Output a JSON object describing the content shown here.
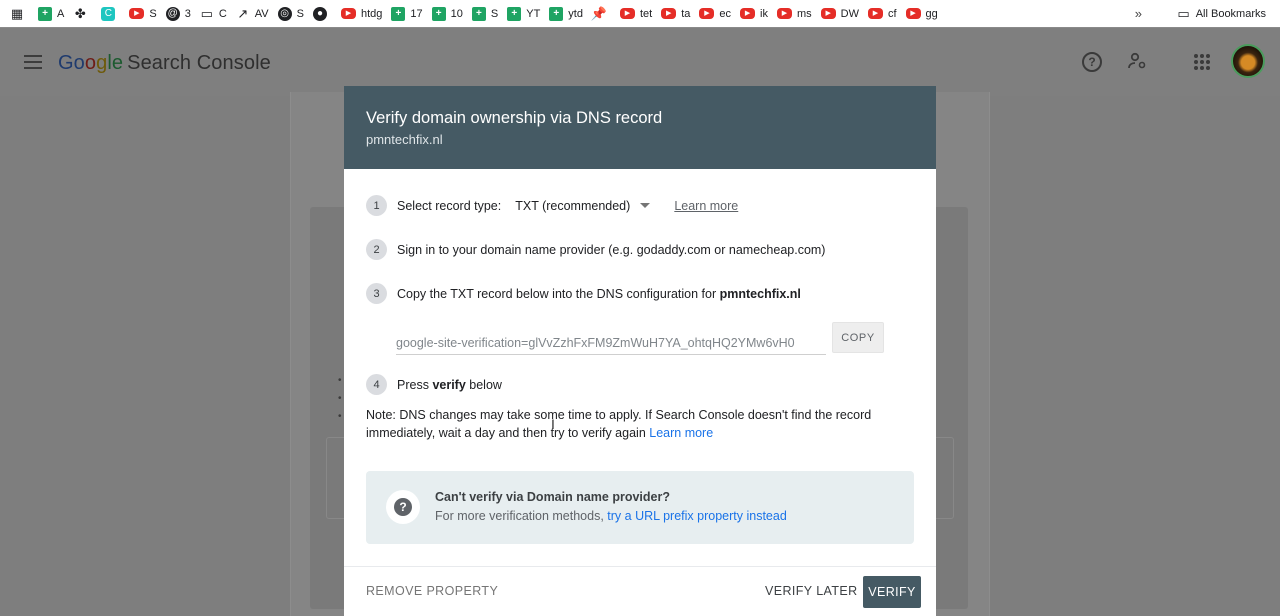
{
  "bookmarks": {
    "items": [
      {
        "label": "",
        "icon": "apps-grid-icon"
      },
      {
        "label": "A",
        "icon": "sheets-icon"
      },
      {
        "label": "",
        "icon": "puzzle-icon"
      },
      {
        "label": "",
        "icon": "canva-icon"
      },
      {
        "label": "S",
        "icon": "youtube-icon"
      },
      {
        "label": "3",
        "icon": "threads-icon"
      },
      {
        "label": "C",
        "icon": "folder-icon"
      },
      {
        "label": "AV",
        "icon": "trend-icon"
      },
      {
        "label": "S",
        "icon": "globe-icon"
      },
      {
        "label": "",
        "icon": "github-icon"
      },
      {
        "label": "htdg",
        "icon": "youtube-icon"
      },
      {
        "label": "17",
        "icon": "sheets-icon"
      },
      {
        "label": "10",
        "icon": "sheets-icon"
      },
      {
        "label": "S",
        "icon": "sheets-icon"
      },
      {
        "label": "YT",
        "icon": "sheets-icon"
      },
      {
        "label": "ytd",
        "icon": "sheets-icon"
      },
      {
        "label": "",
        "icon": "pin-icon"
      },
      {
        "label": "tet",
        "icon": "youtube-icon"
      },
      {
        "label": "ta",
        "icon": "youtube-icon"
      },
      {
        "label": "ec",
        "icon": "youtube-icon"
      },
      {
        "label": "ik",
        "icon": "youtube-icon"
      },
      {
        "label": "ms",
        "icon": "youtube-icon"
      },
      {
        "label": "DW",
        "icon": "youtube-icon"
      },
      {
        "label": "cf",
        "icon": "youtube-icon"
      },
      {
        "label": "gg",
        "icon": "youtube-icon"
      }
    ],
    "more": "»",
    "all_bookmarks": "All Bookmarks"
  },
  "header": {
    "logo_g": [
      "Go",
      "o",
      "g",
      "le"
    ],
    "product": "Search Console",
    "help": "?"
  },
  "dialog": {
    "title": "Verify domain ownership via DNS record",
    "subtitle": "pmntechfix.nl",
    "steps": [
      {
        "num": "1",
        "text": "Select record type:",
        "select_value": "TXT (recommended)",
        "link": "Learn more"
      },
      {
        "num": "2",
        "text": "Sign in to your domain name provider (e.g. godaddy.com or namecheap.com)"
      },
      {
        "num": "3",
        "text_pre": "Copy the TXT record below into the DNS configuration for ",
        "text_bold": "pmntechfix.nl"
      },
      {
        "num": "4",
        "text_pre": "Press ",
        "text_bold": "verify",
        "text_post": " below"
      }
    ],
    "txt_record": "google-site-verification=glVvZzhFxFM9ZmWuH7YA_ohtqHQ2YMw6vH0",
    "copy_label": "COPY",
    "note_text": "Note: DNS changes may take some time to apply. If Search Console doesn't find the record immediately, wait a day and then try to verify again ",
    "note_link": "Learn more",
    "cant_title": "Can't verify via Domain name provider?",
    "cant_desc": "For more verification methods, ",
    "cant_link": "try a URL prefix property instead",
    "remove_label": "REMOVE PROPERTY",
    "later_label": "VERIFY LATER",
    "verify_label": "VERIFY"
  },
  "colors": {
    "dialog_header": "#455a64",
    "link": "#1a73e8",
    "overlay": "#7e7e7e"
  }
}
